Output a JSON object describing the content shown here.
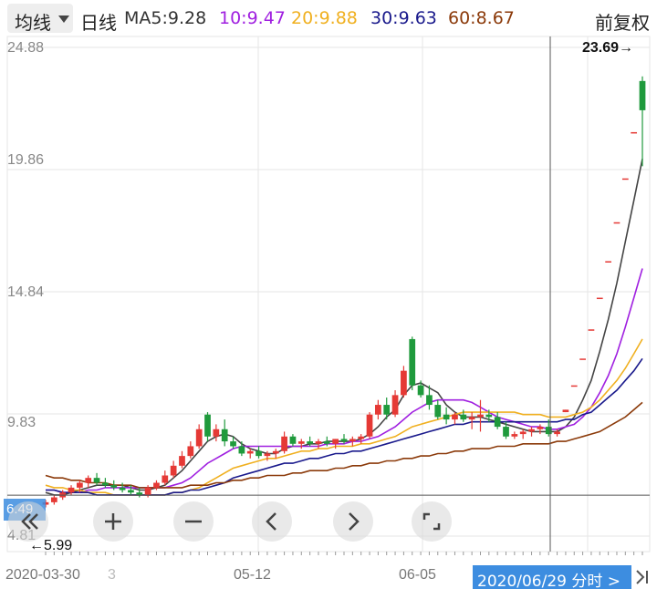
{
  "toolbar": {
    "period_label": "均线",
    "kline_type": "日线",
    "adjust_label": "前复权"
  },
  "ma_legend": [
    {
      "text": "MA5:9.28",
      "color": "#333333"
    },
    {
      "text": "10:9.47",
      "color": "#a020e0"
    },
    {
      "text": "20:9.88",
      "color": "#f0b020"
    },
    {
      "text": "30:9.63",
      "color": "#1a1a8c"
    },
    {
      "text": "60:8.67",
      "color": "#8b3a0a"
    }
  ],
  "y_axis": {
    "labels": [
      "24.88",
      "19.86",
      "14.84",
      "9.83",
      "4.81"
    ]
  },
  "x_axis": {
    "labels": [
      "2020-03-30",
      "05-12",
      "06-05"
    ],
    "extra": "3"
  },
  "annotations": {
    "high": "23.69→",
    "low": "←5.99"
  },
  "cursor": {
    "date_label": "2020/06/29 分时 >",
    "price_flag": "6.49"
  },
  "controls": {
    "prev_page": "«",
    "zoom_in": "+",
    "zoom_out": "−",
    "step_left": "‹",
    "step_right": "›",
    "fullscreen": "⤢"
  },
  "colors": {
    "up": "#e53935",
    "down": "#1f9a3c",
    "grid": "#e6e6e6",
    "cursor": "#555555"
  },
  "chart_data": {
    "type": "candlestick",
    "ylim": [
      4.81,
      24.88
    ],
    "candles": [
      {
        "o": 6.1,
        "h": 6.3,
        "l": 5.99,
        "c": 6.2
      },
      {
        "o": 6.2,
        "h": 6.5,
        "l": 6.1,
        "c": 6.4
      },
      {
        "o": 6.4,
        "h": 6.7,
        "l": 6.3,
        "c": 6.6
      },
      {
        "o": 6.6,
        "h": 6.9,
        "l": 6.5,
        "c": 6.8
      },
      {
        "o": 6.8,
        "h": 7.1,
        "l": 6.6,
        "c": 7.0
      },
      {
        "o": 7.0,
        "h": 7.3,
        "l": 6.8,
        "c": 7.2
      },
      {
        "o": 7.2,
        "h": 7.4,
        "l": 6.9,
        "c": 7.0
      },
      {
        "o": 7.0,
        "h": 7.2,
        "l": 6.8,
        "c": 6.9
      },
      {
        "o": 6.9,
        "h": 7.1,
        "l": 6.7,
        "c": 6.8
      },
      {
        "o": 6.8,
        "h": 7.0,
        "l": 6.6,
        "c": 6.7
      },
      {
        "o": 6.7,
        "h": 6.9,
        "l": 6.5,
        "c": 6.6
      },
      {
        "o": 6.6,
        "h": 6.8,
        "l": 6.4,
        "c": 6.5
      },
      {
        "o": 6.5,
        "h": 6.9,
        "l": 6.4,
        "c": 6.8
      },
      {
        "o": 6.8,
        "h": 7.1,
        "l": 6.7,
        "c": 7.0
      },
      {
        "o": 7.0,
        "h": 7.5,
        "l": 6.9,
        "c": 7.3
      },
      {
        "o": 7.3,
        "h": 7.9,
        "l": 7.2,
        "c": 7.7
      },
      {
        "o": 7.7,
        "h": 8.3,
        "l": 7.6,
        "c": 8.1
      },
      {
        "o": 8.1,
        "h": 8.7,
        "l": 8.0,
        "c": 8.5
      },
      {
        "o": 8.5,
        "h": 9.4,
        "l": 8.4,
        "c": 9.2
      },
      {
        "o": 9.8,
        "h": 9.9,
        "l": 8.7,
        "c": 8.9
      },
      {
        "o": 8.9,
        "h": 9.4,
        "l": 8.7,
        "c": 9.2
      },
      {
        "o": 9.2,
        "h": 9.6,
        "l": 8.5,
        "c": 8.7
      },
      {
        "o": 8.7,
        "h": 8.9,
        "l": 8.4,
        "c": 8.5
      },
      {
        "o": 8.5,
        "h": 8.7,
        "l": 8.1,
        "c": 8.2
      },
      {
        "o": 8.2,
        "h": 8.4,
        "l": 8.0,
        "c": 8.3
      },
      {
        "o": 8.3,
        "h": 8.5,
        "l": 8.0,
        "c": 8.1
      },
      {
        "o": 8.1,
        "h": 8.3,
        "l": 7.9,
        "c": 8.2
      },
      {
        "o": 8.2,
        "h": 8.4,
        "l": 8.0,
        "c": 8.3
      },
      {
        "o": 8.3,
        "h": 9.1,
        "l": 8.2,
        "c": 8.9
      },
      {
        "o": 8.9,
        "h": 9.0,
        "l": 8.5,
        "c": 8.6
      },
      {
        "o": 8.6,
        "h": 8.8,
        "l": 8.4,
        "c": 8.7
      },
      {
        "o": 8.7,
        "h": 8.9,
        "l": 8.5,
        "c": 8.6
      },
      {
        "o": 8.6,
        "h": 8.8,
        "l": 8.4,
        "c": 8.7
      },
      {
        "o": 8.7,
        "h": 8.9,
        "l": 8.5,
        "c": 8.6
      },
      {
        "o": 8.6,
        "h": 8.8,
        "l": 8.4,
        "c": 8.8
      },
      {
        "o": 8.8,
        "h": 9.0,
        "l": 8.6,
        "c": 8.7
      },
      {
        "o": 8.7,
        "h": 8.9,
        "l": 8.5,
        "c": 8.8
      },
      {
        "o": 8.8,
        "h": 9.0,
        "l": 8.6,
        "c": 8.9
      },
      {
        "o": 8.9,
        "h": 9.9,
        "l": 8.8,
        "c": 9.8
      },
      {
        "o": 9.8,
        "h": 10.4,
        "l": 9.6,
        "c": 10.2
      },
      {
        "o": 10.2,
        "h": 10.5,
        "l": 9.6,
        "c": 9.8
      },
      {
        "o": 9.8,
        "h": 10.8,
        "l": 9.7,
        "c": 10.6
      },
      {
        "o": 10.6,
        "h": 11.8,
        "l": 10.5,
        "c": 11.6
      },
      {
        "o": 12.9,
        "h": 13.0,
        "l": 10.8,
        "c": 11.0
      },
      {
        "o": 11.0,
        "h": 11.2,
        "l": 10.5,
        "c": 10.6
      },
      {
        "o": 10.6,
        "h": 11.0,
        "l": 10.0,
        "c": 10.2
      },
      {
        "o": 10.2,
        "h": 10.4,
        "l": 9.6,
        "c": 9.7
      },
      {
        "o": 9.8,
        "h": 10.1,
        "l": 9.4,
        "c": 9.6
      },
      {
        "o": 9.6,
        "h": 9.9,
        "l": 9.4,
        "c": 9.8
      },
      {
        "o": 9.8,
        "h": 10.0,
        "l": 9.5,
        "c": 9.6
      },
      {
        "o": 9.6,
        "h": 9.9,
        "l": 9.2,
        "c": 9.7
      },
      {
        "o": 9.7,
        "h": 10.4,
        "l": 9.1,
        "c": 9.8
      },
      {
        "o": 9.8,
        "h": 10.0,
        "l": 9.5,
        "c": 9.7
      },
      {
        "o": 9.7,
        "h": 9.9,
        "l": 9.2,
        "c": 9.3
      },
      {
        "o": 9.3,
        "h": 9.5,
        "l": 8.8,
        "c": 8.9
      },
      {
        "o": 8.9,
        "h": 9.1,
        "l": 8.8,
        "c": 9.0
      },
      {
        "o": 9.0,
        "h": 9.2,
        "l": 8.8,
        "c": 9.1
      },
      {
        "o": 9.1,
        "h": 9.3,
        "l": 8.9,
        "c": 9.2
      },
      {
        "o": 9.2,
        "h": 9.4,
        "l": 9.0,
        "c": 9.3
      },
      {
        "o": 9.3,
        "h": 9.6,
        "l": 8.9,
        "c": 9.0
      },
      {
        "o": 9.0,
        "h": 9.2,
        "l": 8.9,
        "c": 9.1
      },
      {
        "o": 9.9,
        "h": 10.0,
        "l": 9.9,
        "c": 10.0
      },
      {
        "o": 11.0,
        "h": 11.0,
        "l": 11.0,
        "c": 11.0
      },
      {
        "o": 12.1,
        "h": 12.1,
        "l": 12.1,
        "c": 12.1
      },
      {
        "o": 13.3,
        "h": 13.3,
        "l": 13.3,
        "c": 13.3
      },
      {
        "o": 14.6,
        "h": 14.6,
        "l": 14.6,
        "c": 14.6
      },
      {
        "o": 16.1,
        "h": 16.1,
        "l": 16.1,
        "c": 16.1
      },
      {
        "o": 17.7,
        "h": 17.7,
        "l": 17.7,
        "c": 17.7
      },
      {
        "o": 19.5,
        "h": 19.5,
        "l": 19.5,
        "c": 19.5
      },
      {
        "o": 21.4,
        "h": 21.4,
        "l": 21.4,
        "c": 21.4
      },
      {
        "o": 23.5,
        "h": 23.69,
        "l": 20.0,
        "c": 22.3
      }
    ],
    "ma_lines": [
      {
        "name": "MA5",
        "color": "#444444",
        "values": [
          6.6,
          6.5,
          6.5,
          6.6,
          6.7,
          6.8,
          6.9,
          6.9,
          6.9,
          6.9,
          6.8,
          6.7,
          6.7,
          6.8,
          6.9,
          7.2,
          7.5,
          7.9,
          8.3,
          8.7,
          8.9,
          9.0,
          8.9,
          8.6,
          8.4,
          8.3,
          8.2,
          8.2,
          8.4,
          8.5,
          8.5,
          8.6,
          8.6,
          8.7,
          8.7,
          8.7,
          8.7,
          8.8,
          9.0,
          9.3,
          9.7,
          10.0,
          10.6,
          11.0,
          11.1,
          10.9,
          10.7,
          10.2,
          9.9,
          9.7,
          9.7,
          9.7,
          9.6,
          9.5,
          9.4,
          9.3,
          9.2,
          9.1,
          9.1,
          9.1,
          9.1,
          9.3,
          9.7,
          10.4,
          11.2,
          12.4,
          13.7,
          15.2,
          16.9,
          18.6,
          20.3
        ]
      },
      {
        "name": "10",
        "color": "#a020e0",
        "values": [
          6.7,
          6.7,
          6.6,
          6.6,
          6.6,
          6.7,
          6.7,
          6.8,
          6.8,
          6.8,
          6.8,
          6.8,
          6.8,
          6.8,
          6.8,
          6.9,
          7.0,
          7.2,
          7.5,
          7.8,
          8.0,
          8.2,
          8.4,
          8.5,
          8.5,
          8.5,
          8.5,
          8.5,
          8.5,
          8.5,
          8.5,
          8.5,
          8.5,
          8.6,
          8.6,
          8.6,
          8.7,
          8.7,
          8.8,
          8.9,
          9.1,
          9.3,
          9.6,
          9.9,
          10.1,
          10.3,
          10.4,
          10.4,
          10.4,
          10.4,
          10.3,
          10.1,
          9.9,
          9.7,
          9.6,
          9.5,
          9.4,
          9.3,
          9.3,
          9.2,
          9.2,
          9.3,
          9.4,
          9.7,
          10.1,
          10.7,
          11.4,
          12.3,
          13.4,
          14.6,
          15.8
        ]
      },
      {
        "name": "20",
        "color": "#f0b020",
        "values": [
          6.9,
          6.8,
          6.8,
          6.7,
          6.7,
          6.6,
          6.6,
          6.6,
          6.5,
          6.5,
          6.5,
          6.5,
          6.5,
          6.5,
          6.5,
          6.6,
          6.6,
          6.7,
          6.8,
          7.0,
          7.2,
          7.4,
          7.6,
          7.7,
          7.8,
          7.9,
          8.0,
          8.0,
          8.1,
          8.2,
          8.3,
          8.3,
          8.4,
          8.4,
          8.5,
          8.5,
          8.5,
          8.6,
          8.6,
          8.7,
          8.8,
          8.9,
          9.1,
          9.3,
          9.4,
          9.5,
          9.6,
          9.7,
          9.8,
          9.9,
          9.9,
          9.9,
          9.9,
          9.9,
          9.9,
          9.9,
          9.8,
          9.8,
          9.8,
          9.7,
          9.7,
          9.7,
          9.8,
          9.9,
          10.1,
          10.4,
          10.8,
          11.2,
          11.7,
          12.3,
          12.9
        ]
      },
      {
        "name": "30",
        "color": "#1a1a8c",
        "values": [
          6.7,
          6.7,
          6.6,
          6.6,
          6.6,
          6.6,
          6.5,
          6.5,
          6.5,
          6.5,
          6.5,
          6.5,
          6.5,
          6.5,
          6.5,
          6.6,
          6.6,
          6.7,
          6.7,
          6.8,
          6.9,
          7.0,
          7.2,
          7.3,
          7.4,
          7.5,
          7.6,
          7.7,
          7.8,
          7.8,
          7.9,
          8.0,
          8.0,
          8.1,
          8.2,
          8.2,
          8.3,
          8.3,
          8.4,
          8.5,
          8.6,
          8.7,
          8.8,
          8.9,
          9.0,
          9.1,
          9.2,
          9.3,
          9.4,
          9.4,
          9.5,
          9.5,
          9.5,
          9.5,
          9.5,
          9.5,
          9.5,
          9.5,
          9.5,
          9.5,
          9.5,
          9.6,
          9.6,
          9.8,
          9.9,
          10.2,
          10.5,
          10.8,
          11.2,
          11.6,
          12.1
        ]
      },
      {
        "name": "60",
        "color": "#8b3a0a",
        "values": [
          7.3,
          7.2,
          7.2,
          7.1,
          7.1,
          7.0,
          7.0,
          7.0,
          6.9,
          6.9,
          6.9,
          6.8,
          6.8,
          6.8,
          6.8,
          6.8,
          6.8,
          6.9,
          6.9,
          6.9,
          7.0,
          7.0,
          7.1,
          7.1,
          7.2,
          7.2,
          7.3,
          7.3,
          7.3,
          7.4,
          7.4,
          7.5,
          7.5,
          7.5,
          7.6,
          7.6,
          7.7,
          7.7,
          7.8,
          7.8,
          7.9,
          7.9,
          8.0,
          8.0,
          8.1,
          8.1,
          8.2,
          8.2,
          8.3,
          8.3,
          8.4,
          8.4,
          8.4,
          8.5,
          8.5,
          8.5,
          8.6,
          8.6,
          8.6,
          8.6,
          8.7,
          8.7,
          8.8,
          8.9,
          9.0,
          9.1,
          9.3,
          9.5,
          9.7,
          10.0,
          10.3
        ]
      }
    ]
  }
}
